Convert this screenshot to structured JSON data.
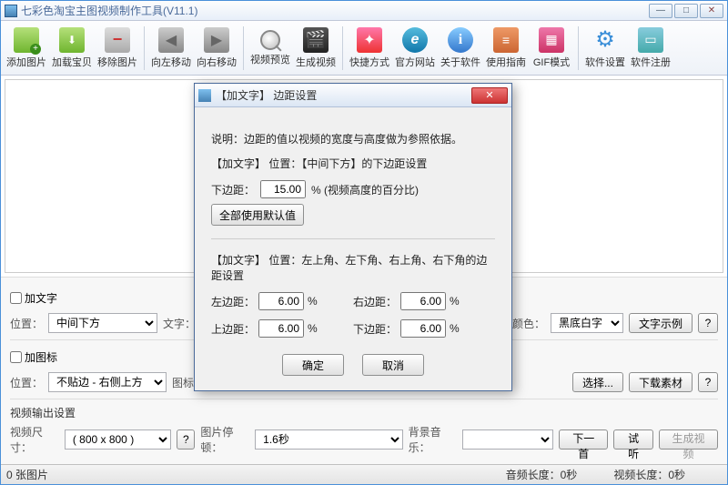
{
  "window": {
    "title": "七彩色淘宝主图视频制作工具(V11.1)",
    "min": "—",
    "max": "□",
    "close": "✕"
  },
  "toolbar": {
    "addImage": "添加图片",
    "loadItem": "加载宝贝",
    "removeImage": "移除图片",
    "moveLeft": "向左移动",
    "moveRight": "向右移动",
    "preview": "视频预览",
    "generate": "生成视频",
    "shortcut": "快捷方式",
    "website": "官方网站",
    "about": "关于软件",
    "guide": "使用指南",
    "gif": "GIF模式",
    "settings": "软件设置",
    "register": "软件注册"
  },
  "addText": {
    "checkbox": "加文字",
    "posLabel": "位置：",
    "posValue": "中间下方",
    "textLabel": "文字：",
    "textValue": "",
    "colorLabel": "颜色：",
    "colorValue": "黑底白字",
    "sampleBtn": "文字示例",
    "q": "?"
  },
  "addIcon": {
    "checkbox": "加图标",
    "posLabel": "位置：",
    "posValue": "不贴边 - 右侧上方",
    "iconLabel": "图标：",
    "selectBtn": "选择...",
    "downloadBtn": "下载素材",
    "q": "?"
  },
  "output": {
    "title": "视频输出设置",
    "sizeLabel": "视频尺寸：",
    "sizeValue": "( 800 x  800 )",
    "frameLabel": "图片停顿：",
    "frameValue": "1.6秒",
    "bgmLabel": "背景音乐：",
    "bgmValue": "",
    "nextBtn": "下一首",
    "tryBtn": "试听",
    "genBtn": "生成视频",
    "q": "?"
  },
  "status": {
    "count": "0 张图片",
    "audioLen": "音频长度：0秒",
    "videoLen": "视频长度：0秒"
  },
  "dialog": {
    "title": "【加文字】 边距设置",
    "desc": "说明：边距的值以视频的宽度与高度做为参照依据。",
    "sec1": "【加文字】 位置：【中间下方】的下边距设置",
    "bottomLabel": "下边距：",
    "bottomVal": "15.00",
    "bottomHint": "% (视频高度的百分比)",
    "defaultBtn": "全部使用默认值",
    "sec2": "【加文字】 位置：左上角、左下角、右上角、右下角的边距设置",
    "leftLabel": "左边距：",
    "leftVal": "6.00",
    "rightLabel": "右边距：",
    "rightVal": "6.00",
    "topLabel": "上边距：",
    "topVal": "6.00",
    "bot2Label": "下边距：",
    "bot2Val": "6.00",
    "pct": "%",
    "ok": "确定",
    "cancel": "取消"
  }
}
